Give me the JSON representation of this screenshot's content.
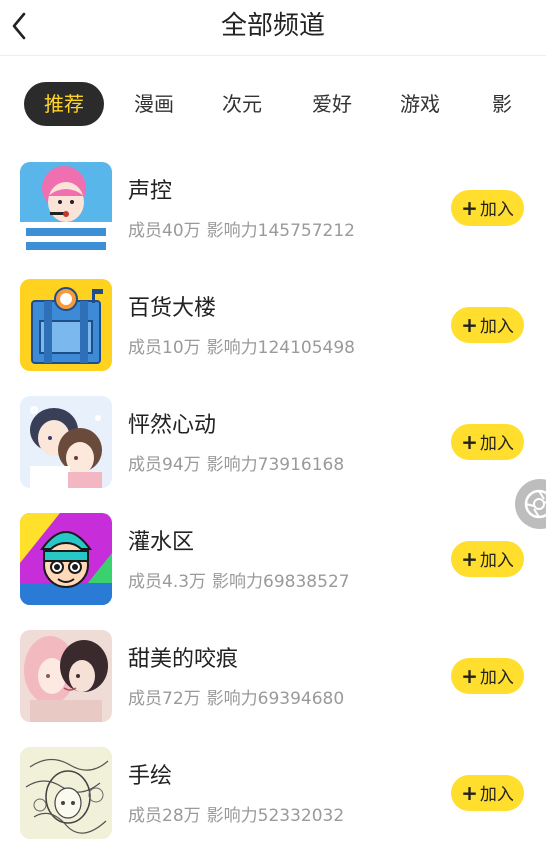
{
  "header": {
    "title": "全部频道",
    "back_icon": "chevron-left-icon"
  },
  "tabs": [
    {
      "label": "推荐",
      "active": true
    },
    {
      "label": "漫画",
      "active": false
    },
    {
      "label": "次元",
      "active": false
    },
    {
      "label": "爱好",
      "active": false
    },
    {
      "label": "游戏",
      "active": false
    },
    {
      "label": "影",
      "active": false
    }
  ],
  "channels": [
    {
      "name": "声控",
      "members": "成员40万",
      "influence": "影响力145757212",
      "join_label": "加入"
    },
    {
      "name": "百货大楼",
      "members": "成员10万",
      "influence": "影响力124105498",
      "join_label": "加入"
    },
    {
      "name": "怦然心动",
      "members": "成员94万",
      "influence": "影响力73916168",
      "join_label": "加入"
    },
    {
      "name": "灌水区",
      "members": "成员4.3万",
      "influence": "影响力69838527",
      "join_label": "加入"
    },
    {
      "name": "甜美的咬痕",
      "members": "成员72万",
      "influence": "影响力69394680",
      "join_label": "加入"
    },
    {
      "name": "手绘",
      "members": "成员28万",
      "influence": "影响力52332032",
      "join_label": "加入"
    }
  ],
  "floating_button": {
    "icon": "camera-shutter-icon"
  },
  "colors": {
    "accent_yellow": "#ffde2e",
    "active_tab_bg": "#2b2b2b",
    "active_tab_text": "#ffd42a",
    "meta_text": "#9a9a9a"
  }
}
